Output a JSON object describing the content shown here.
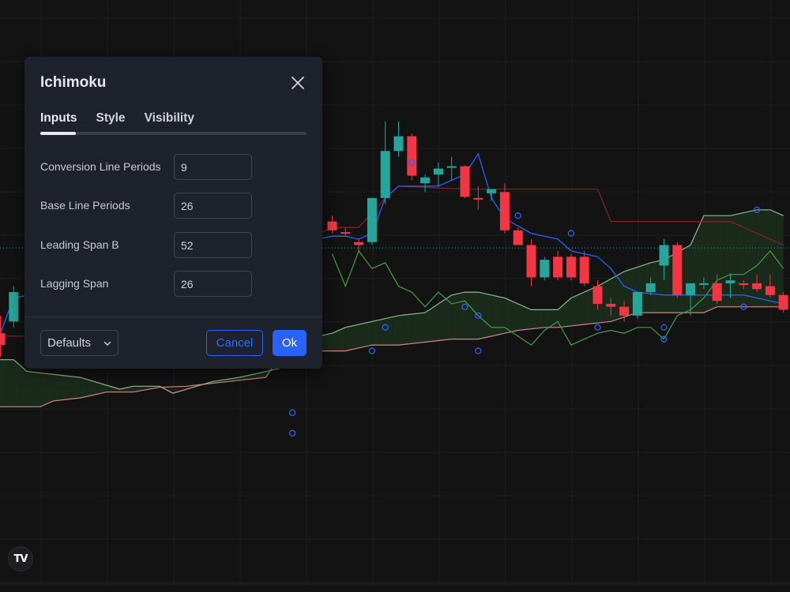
{
  "dialog": {
    "title": "Ichimoku",
    "tabs": [
      {
        "label": "Inputs"
      },
      {
        "label": "Style"
      },
      {
        "label": "Visibility"
      }
    ],
    "active_tab": "Inputs",
    "fields": [
      {
        "label": "Conversion Line Periods",
        "value": "9"
      },
      {
        "label": "Base Line Periods",
        "value": "26"
      },
      {
        "label": "Leading Span B",
        "value": "52"
      },
      {
        "label": "Lagging Span",
        "value": "26"
      }
    ],
    "defaults_label": "Defaults",
    "cancel_label": "Cancel",
    "ok_label": "Ok"
  },
  "logo": {
    "text": "TV",
    "icon": "tradingview-logo-icon"
  },
  "colors": {
    "background": "#131313",
    "grid": "#1f1f1f",
    "bull": "#26a69a",
    "bear": "#f23645",
    "conversion_line": "#2962ff",
    "base_line": "#8b1e2d",
    "lagging_span": "#43a047",
    "leading_span_a": "#a5d6a7",
    "leading_span_b": "#ef9a9a",
    "cloud_bull": "#1b2b1b",
    "cloud_bear": "#2b1515",
    "accent": "#2962ff"
  },
  "chart_data": {
    "type": "candlestick",
    "indicator": "Ichimoku",
    "candles": [
      {
        "i": 0,
        "o": 44,
        "h": 47,
        "l": 40,
        "c": 42
      },
      {
        "i": 1,
        "o": 46,
        "h": 52,
        "l": 45,
        "c": 51
      },
      {
        "i": 25,
        "o": 63,
        "h": 64,
        "l": 61,
        "c": 61.5
      },
      {
        "i": 26,
        "o": 61.2,
        "h": 62,
        "l": 60.5,
        "c": 61
      },
      {
        "i": 27,
        "o": 59.5,
        "h": 60,
        "l": 58,
        "c": 59
      },
      {
        "i": 28,
        "o": 59.5,
        "h": 67,
        "l": 59,
        "c": 67
      },
      {
        "i": 29,
        "o": 67,
        "h": 80,
        "l": 66,
        "c": 75
      },
      {
        "i": 30,
        "o": 75,
        "h": 80,
        "l": 74,
        "c": 77.5
      },
      {
        "i": 31,
        "o": 77.5,
        "h": 78,
        "l": 70,
        "c": 70.8
      },
      {
        "i": 32,
        "o": 69.5,
        "h": 71,
        "l": 68,
        "c": 70.5
      },
      {
        "i": 33,
        "o": 71,
        "h": 73,
        "l": 69,
        "c": 72
      },
      {
        "i": 34,
        "o": 72.4,
        "h": 74,
        "l": 70,
        "c": 72.4
      },
      {
        "i": 35,
        "o": 72.4,
        "h": 72.6,
        "l": 67,
        "c": 67.2
      },
      {
        "i": 36,
        "o": 67,
        "h": 69,
        "l": 65,
        "c": 66.8
      },
      {
        "i": 37,
        "o": 67.8,
        "h": 68.5,
        "l": 66.5,
        "c": 68.5
      },
      {
        "i": 38,
        "o": 68,
        "h": 69.5,
        "l": 61,
        "c": 61.5
      },
      {
        "i": 39,
        "o": 61.5,
        "h": 62,
        "l": 59,
        "c": 59
      },
      {
        "i": 40,
        "o": 59,
        "h": 60,
        "l": 52,
        "c": 53.5
      },
      {
        "i": 41,
        "o": 53.5,
        "h": 57,
        "l": 53,
        "c": 56.5
      },
      {
        "i": 42,
        "o": 57,
        "h": 58,
        "l": 53,
        "c": 53.5
      },
      {
        "i": 43,
        "o": 57,
        "h": 57.5,
        "l": 53,
        "c": 53.5
      },
      {
        "i": 44,
        "o": 57,
        "h": 58,
        "l": 52,
        "c": 52.5
      },
      {
        "i": 45,
        "o": 52,
        "h": 53,
        "l": 48,
        "c": 49
      },
      {
        "i": 46,
        "o": 49,
        "h": 50,
        "l": 47,
        "c": 48.5
      },
      {
        "i": 47,
        "o": 48.5,
        "h": 49.5,
        "l": 46,
        "c": 47
      },
      {
        "i": 48,
        "o": 47,
        "h": 51,
        "l": 46.5,
        "c": 51
      },
      {
        "i": 49,
        "o": 51,
        "h": 53.5,
        "l": 50.5,
        "c": 52.5
      },
      {
        "i": 50,
        "o": 55.5,
        "h": 60,
        "l": 53,
        "c": 59
      },
      {
        "i": 51,
        "o": 59,
        "h": 59.5,
        "l": 50,
        "c": 50.5
      },
      {
        "i": 52,
        "o": 50.5,
        "h": 52.5,
        "l": 47,
        "c": 52.5
      },
      {
        "i": 53,
        "o": 52.5,
        "h": 53.5,
        "l": 51.5,
        "c": 52.5
      },
      {
        "i": 54,
        "o": 52.5,
        "h": 54,
        "l": 49,
        "c": 49.5
      },
      {
        "i": 55,
        "o": 52.5,
        "h": 54.2,
        "l": 50,
        "c": 53
      },
      {
        "i": 56,
        "o": 52.5,
        "h": 53,
        "l": 51.5,
        "c": 52.2
      },
      {
        "i": 57,
        "o": 52.5,
        "h": 54,
        "l": 51,
        "c": 51.5
      },
      {
        "i": 58,
        "o": 52,
        "h": 54,
        "l": 50,
        "c": 50.5
      },
      {
        "i": 59,
        "o": 50.5,
        "h": 51,
        "l": 47.5,
        "c": 48
      }
    ],
    "conversion_line": [
      [
        0,
        44
      ],
      [
        1,
        50
      ],
      [
        25,
        60.5
      ],
      [
        26,
        60.5
      ],
      [
        27,
        60
      ],
      [
        28,
        61
      ],
      [
        29,
        67
      ],
      [
        30,
        69
      ],
      [
        33,
        69
      ],
      [
        35,
        71
      ],
      [
        36,
        74.5
      ],
      [
        37,
        67
      ],
      [
        38,
        63.5
      ],
      [
        40,
        61
      ],
      [
        42,
        60
      ],
      [
        43,
        58
      ],
      [
        45,
        57
      ],
      [
        46,
        55
      ],
      [
        47,
        52
      ],
      [
        48,
        51
      ],
      [
        50,
        50.5
      ],
      [
        56,
        50.5
      ],
      [
        59,
        49
      ]
    ],
    "base_line": [
      [
        0,
        43.5
      ],
      [
        8,
        43.5
      ],
      [
        9,
        45
      ],
      [
        25,
        62
      ],
      [
        27,
        62
      ],
      [
        29,
        67
      ],
      [
        30,
        69
      ],
      [
        35,
        68.5
      ],
      [
        40,
        68.5
      ],
      [
        45,
        68.5
      ],
      [
        46,
        63
      ],
      [
        49,
        63
      ],
      [
        55,
        63
      ],
      [
        59,
        59
      ]
    ],
    "lagging_span": [
      [
        25,
        57.5
      ],
      [
        26,
        52
      ],
      [
        27,
        58
      ],
      [
        28,
        55
      ],
      [
        29,
        56
      ],
      [
        30,
        52
      ],
      [
        31,
        51
      ],
      [
        32,
        48.5
      ],
      [
        33,
        51
      ],
      [
        34,
        49
      ],
      [
        35,
        49.5
      ],
      [
        36,
        47
      ],
      [
        37,
        45
      ],
      [
        38,
        45
      ],
      [
        39,
        43.5
      ],
      [
        40,
        42
      ],
      [
        41,
        44.5
      ],
      [
        42,
        46
      ],
      [
        43,
        42
      ],
      [
        44,
        43
      ],
      [
        45,
        44
      ],
      [
        46,
        44.5
      ],
      [
        47,
        44
      ],
      [
        48,
        45
      ],
      [
        49,
        45
      ],
      [
        50,
        43
      ],
      [
        51,
        47
      ],
      [
        52,
        48
      ],
      [
        53,
        50
      ],
      [
        54,
        53
      ],
      [
        55,
        54
      ],
      [
        56,
        54
      ],
      [
        57,
        55.5
      ],
      [
        58,
        58
      ],
      [
        59,
        55
      ]
    ],
    "leading_span_a": [
      [
        -1,
        39.5
      ],
      [
        1,
        39.5
      ],
      [
        2,
        37.5
      ],
      [
        6,
        36.5
      ],
      [
        9,
        34.5
      ],
      [
        10,
        35
      ],
      [
        12,
        35
      ],
      [
        13,
        33.8
      ],
      [
        16,
        35.8
      ],
      [
        18,
        36.5
      ],
      [
        21,
        38
      ],
      [
        22,
        42
      ],
      [
        23,
        43
      ],
      [
        25,
        44
      ],
      [
        26,
        45
      ],
      [
        28,
        46
      ],
      [
        30,
        47
      ],
      [
        32,
        47.5
      ],
      [
        34,
        50.5
      ],
      [
        35,
        51
      ],
      [
        36,
        51
      ],
      [
        37,
        50.5
      ],
      [
        38,
        50
      ],
      [
        40,
        48
      ],
      [
        42,
        48
      ],
      [
        43,
        50
      ],
      [
        45,
        52
      ],
      [
        47,
        54.5
      ],
      [
        49,
        56
      ],
      [
        50,
        56.5
      ],
      [
        52,
        59
      ],
      [
        53,
        64
      ],
      [
        55,
        64
      ],
      [
        57,
        65
      ],
      [
        58,
        65
      ],
      [
        59,
        64
      ]
    ],
    "leading_span_b": [
      [
        -1,
        31.5
      ],
      [
        3,
        31.5
      ],
      [
        4,
        32.5
      ],
      [
        6,
        33
      ],
      [
        8,
        34
      ],
      [
        10,
        34
      ],
      [
        12,
        34.8
      ],
      [
        14,
        35
      ],
      [
        16,
        35.5
      ],
      [
        18,
        36
      ],
      [
        20,
        36.5
      ],
      [
        21,
        40
      ],
      [
        22,
        41
      ],
      [
        26,
        41
      ],
      [
        28,
        42
      ],
      [
        30,
        42
      ],
      [
        34,
        43
      ],
      [
        36,
        43
      ],
      [
        39,
        44.5
      ],
      [
        41,
        45
      ],
      [
        42,
        45
      ],
      [
        44,
        45.5
      ],
      [
        46,
        46
      ],
      [
        48,
        47.5
      ],
      [
        50,
        47.5
      ],
      [
        53,
        47.5
      ],
      [
        54,
        48.5
      ],
      [
        56,
        48.5
      ],
      [
        59,
        48.5
      ]
    ],
    "current_price": 58.5
  }
}
